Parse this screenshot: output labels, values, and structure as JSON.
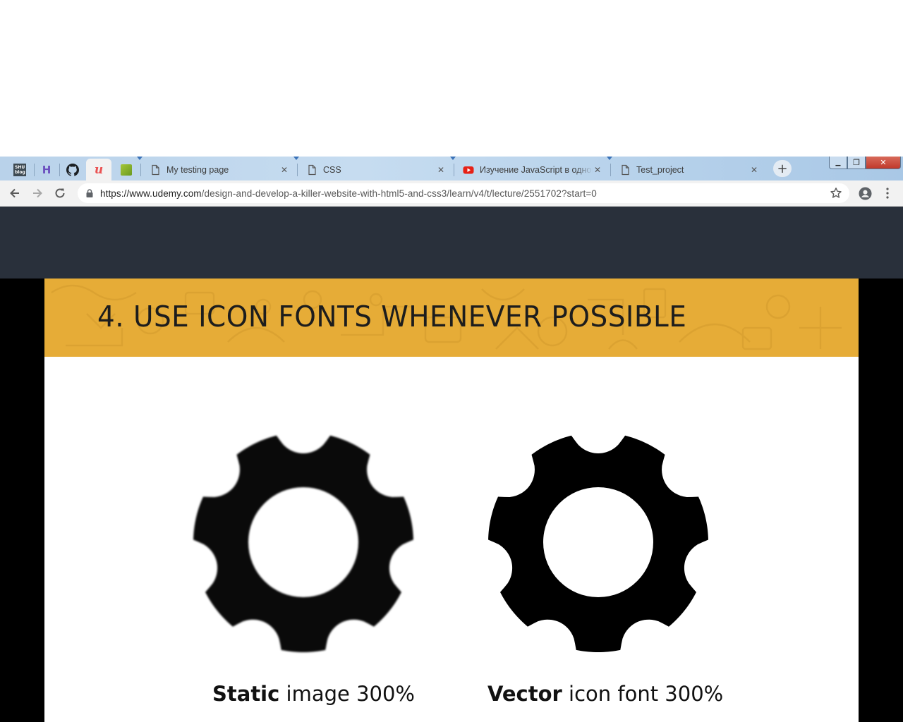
{
  "browser": {
    "pinned_tabs": [
      {
        "icon": "shu-blog-icon",
        "label": "SHU blog"
      },
      {
        "icon": "h-icon",
        "label": "H"
      },
      {
        "icon": "github-icon",
        "label": ""
      },
      {
        "icon": "udemy-icon",
        "label": "u"
      },
      {
        "icon": "android-icon",
        "label": ""
      }
    ],
    "tabs": [
      {
        "title": "My testing page",
        "icon": "page-icon"
      },
      {
        "title": "CSS",
        "icon": "page-icon"
      },
      {
        "title": "Изучение JavaScript в одном",
        "icon": "youtube-icon"
      },
      {
        "title": "Test_project",
        "icon": "page-icon"
      }
    ],
    "close_glyph": "✕",
    "new_tab_glyph": "+",
    "window_controls": {
      "minimize": "▁",
      "restore": "❐",
      "close": "✕"
    },
    "url_host": "https://www.udemy.com",
    "url_path": "/design-and-develop-a-killer-website-with-html5-and-css3/learn/v4/t/lecture/2551702?start=0",
    "accent": "#3a72b8"
  },
  "slide": {
    "title": "4. USE ICON FONTS WHENEVER POSSIBLE",
    "banner_color": "#e6ac37",
    "left_caption_bold": "Static",
    "left_caption_rest": " image 300%",
    "right_caption_bold": "Vector",
    "right_caption_rest": " icon font 300%"
  }
}
